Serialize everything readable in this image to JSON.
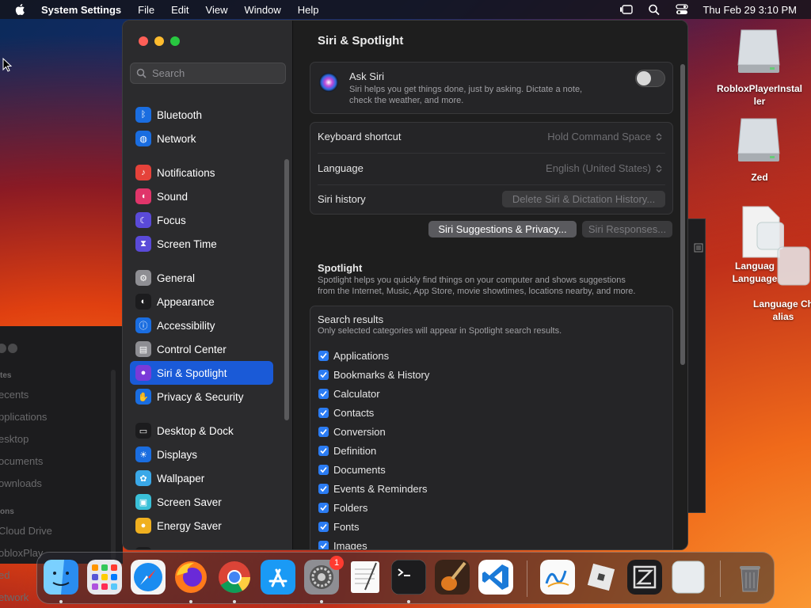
{
  "menubar": {
    "app_name": "System Settings",
    "menus": [
      "File",
      "Edit",
      "View",
      "Window",
      "Help"
    ],
    "clock": "Thu Feb 29  3:10 PM"
  },
  "background_finder": {
    "sections": [
      "tes",
      "ons"
    ],
    "items": [
      "ecents",
      "pplications",
      "esktop",
      "ocuments",
      "ownloads",
      "Cloud Drive",
      "obloxPlay",
      "ed",
      "etwork"
    ]
  },
  "sidebar": {
    "search_placeholder": "Search",
    "items": [
      {
        "label": "Bluetooth",
        "icon": "bluetooth-icon",
        "color": "#1a6de0"
      },
      {
        "label": "Network",
        "icon": "globe-icon",
        "color": "#1a6de0"
      },
      {
        "label": "Notifications",
        "icon": "bell-icon",
        "color": "#e5423a"
      },
      {
        "label": "Sound",
        "icon": "speaker-icon",
        "color": "#e0356a"
      },
      {
        "label": "Focus",
        "icon": "moon-icon",
        "color": "#5a4ad8"
      },
      {
        "label": "Screen Time",
        "icon": "hourglass-icon",
        "color": "#5a4ad8"
      },
      {
        "label": "General",
        "icon": "gear-icon",
        "color": "#8e8e93"
      },
      {
        "label": "Appearance",
        "icon": "appearance-icon",
        "color": "#1c1c1e"
      },
      {
        "label": "Accessibility",
        "icon": "accessibility-icon",
        "color": "#1a6de0"
      },
      {
        "label": "Control Center",
        "icon": "control-center-icon",
        "color": "#8e8e93"
      },
      {
        "label": "Siri & Spotlight",
        "icon": "siri-icon",
        "color": "#7a3ad8"
      },
      {
        "label": "Privacy & Security",
        "icon": "hand-icon",
        "color": "#1a6de0"
      },
      {
        "label": "Desktop & Dock",
        "icon": "dock-icon",
        "color": "#1c1c1e"
      },
      {
        "label": "Displays",
        "icon": "sun-icon",
        "color": "#1a6de0"
      },
      {
        "label": "Wallpaper",
        "icon": "wallpaper-icon",
        "color": "#3aa8e8"
      },
      {
        "label": "Screen Saver",
        "icon": "screensaver-icon",
        "color": "#3ac0d8"
      },
      {
        "label": "Energy Saver",
        "icon": "bulb-icon",
        "color": "#f0b020"
      },
      {
        "label": "Lock Screen",
        "icon": "lock-icon",
        "color": "#1c1c1e"
      }
    ],
    "active_index": 10
  },
  "main": {
    "title": "Siri & Spotlight",
    "ask_siri": {
      "title": "Ask Siri",
      "description_line1": "Siri helps you get things done, just by asking. Dictate a note,",
      "description_line2": "check the weather, and more.",
      "enabled": false
    },
    "keyboard_shortcut": {
      "label": "Keyboard shortcut",
      "value": "Hold Command Space"
    },
    "language": {
      "label": "Language",
      "value": "English (United States)"
    },
    "siri_history": {
      "label": "Siri history",
      "button": "Delete Siri & Dictation History..."
    },
    "suggestions_button": "Siri Suggestions & Privacy...",
    "responses_button": "Siri Responses...",
    "spotlight": {
      "title": "Spotlight",
      "description_line1": "Spotlight helps you quickly find things on your computer and shows suggestions",
      "description_line2": "from the Internet, Music, App Store, movie showtimes, locations nearby, and more."
    },
    "search_results": {
      "title": "Search results",
      "subtitle": "Only selected categories will appear in Spotlight search results.",
      "categories": [
        {
          "label": "Applications",
          "checked": true
        },
        {
          "label": "Bookmarks & History",
          "checked": true
        },
        {
          "label": "Calculator",
          "checked": true
        },
        {
          "label": "Contacts",
          "checked": true
        },
        {
          "label": "Conversion",
          "checked": true
        },
        {
          "label": "Definition",
          "checked": true
        },
        {
          "label": "Documents",
          "checked": true
        },
        {
          "label": "Events & Reminders",
          "checked": true
        },
        {
          "label": "Folders",
          "checked": true
        },
        {
          "label": "Fonts",
          "checked": true
        },
        {
          "label": "Images",
          "checked": true
        }
      ]
    }
  },
  "desktop": {
    "icons": [
      {
        "label_line1": "RobloxPlayerInstal",
        "label_line2": "ler"
      },
      {
        "label_line1": "Zed",
        "label_line2": ""
      },
      {
        "label_line1": "Languag",
        "label_line2": "Language"
      },
      {
        "label_line1": "Language Ch",
        "label_line2": "alias"
      }
    ]
  },
  "dock": {
    "apps": [
      "Finder",
      "Launchpad",
      "Safari",
      "Firefox",
      "Chrome",
      "App Store",
      "System Settings",
      "TextEdit",
      "Terminal",
      "GarageBand",
      "Visual Studio Code",
      "Freeform",
      "Roblox",
      "Zed",
      "Preview"
    ],
    "system_settings_badge": "1"
  }
}
